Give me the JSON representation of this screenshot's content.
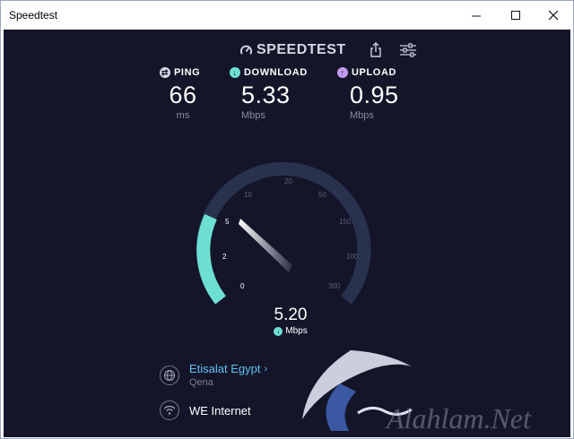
{
  "window": {
    "title": "Speedtest"
  },
  "app": {
    "logo": "SPEEDTEST",
    "ping": {
      "label": "PING",
      "value": "66",
      "unit": "ms"
    },
    "download": {
      "label": "DOWNLOAD",
      "value": "5.33",
      "unit": "Mbps"
    },
    "upload": {
      "label": "UPLOAD",
      "value": "0.95",
      "unit": "Mbps"
    },
    "gauge": {
      "ticks": [
        "0",
        "2",
        "5",
        "10",
        "20",
        "50",
        "150",
        "100",
        "300"
      ],
      "current_value": "5.20",
      "current_unit": "Mbps",
      "needle_tick": "5"
    },
    "isp": {
      "name": "Etisalat Egypt",
      "location": "Qena"
    },
    "server": {
      "name": "WE Internet"
    }
  },
  "watermark": {
    "text": "Alahlam.Net"
  },
  "colors": {
    "background": "#141529",
    "accent": "#6de0d3",
    "track": "#28324f",
    "link": "#5ec2ef",
    "upload": "#c49bf3"
  },
  "icons": [
    "speedtest-logo-icon",
    "share-icon",
    "settings-sliders-icon",
    "ping-icon",
    "download-arrow-icon",
    "upload-arrow-icon",
    "globe-icon",
    "wifi-icon",
    "chevron-right-icon"
  ]
}
